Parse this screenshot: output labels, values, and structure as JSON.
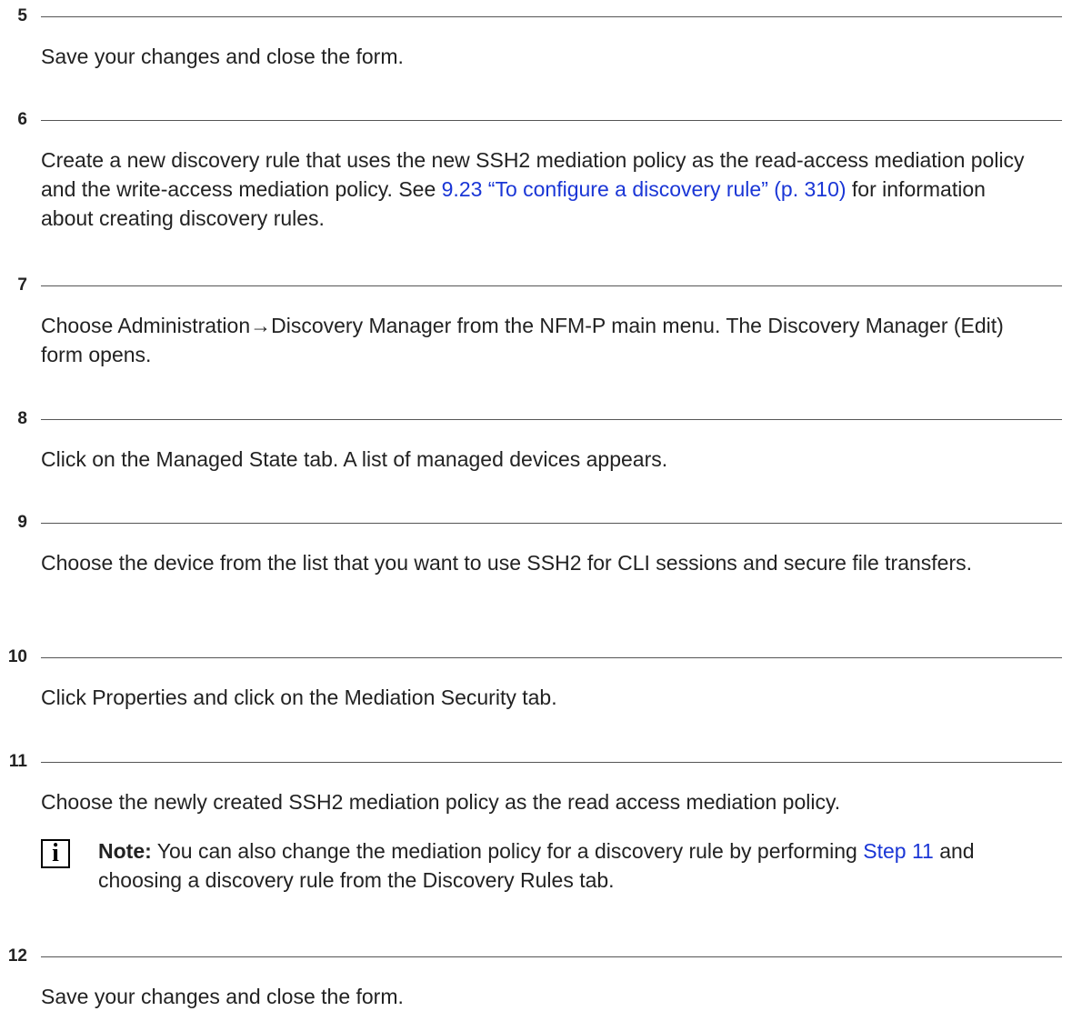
{
  "steps": [
    {
      "number": "5",
      "text": "Save your changes and close the form."
    },
    {
      "number": "6",
      "text_before": "Create a new discovery rule that uses the new SSH2 mediation policy as the read-access mediation policy and the write-access mediation policy. See ",
      "link": "9.23 “To configure a discovery rule” (p. 310)",
      "text_after": " for information about creating discovery rules."
    },
    {
      "number": "7",
      "text": "Choose Administration→Discovery Manager from the NFM-P main menu. The Discovery Manager (Edit) form opens."
    },
    {
      "number": "8",
      "text": "Click on the Managed State tab. A list of managed devices appears."
    },
    {
      "number": "9",
      "text": "Choose the device from the list that you want to use SSH2 for CLI sessions and secure file transfers."
    },
    {
      "number": "10",
      "text": "Click Properties and click on the Mediation Security tab."
    },
    {
      "number": "11",
      "text": "Choose the newly created SSH2 mediation policy as the read access mediation policy.",
      "note": {
        "icon": "info-icon",
        "icon_glyph": "i",
        "label": "Note:",
        "text_before": " You can also change the mediation policy for a discovery rule by performing ",
        "link": "Step 11",
        "text_after": " and choosing a discovery rule from the Discovery Rules tab."
      }
    },
    {
      "number": "12",
      "text": "Save your changes and close the form."
    }
  ],
  "colors": {
    "link": "#1a36d6",
    "text": "#222222",
    "rule": "#555555"
  }
}
